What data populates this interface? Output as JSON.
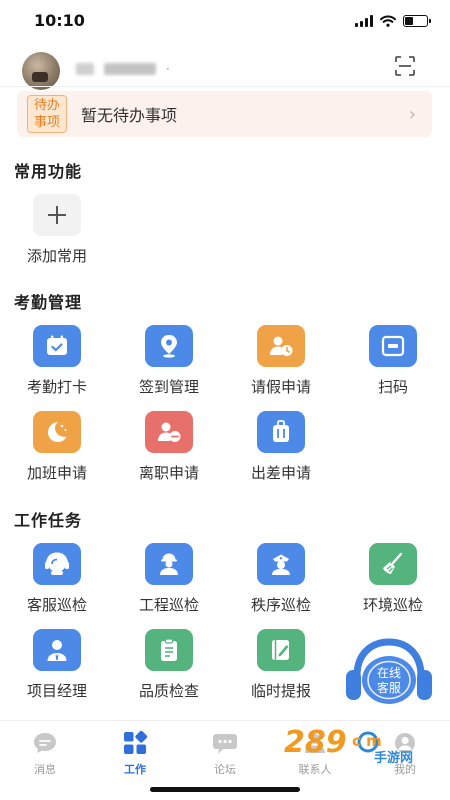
{
  "status_bar": {
    "time": "10:10",
    "battery_level": 0.4
  },
  "header": {
    "avatar_icon": "user-avatar",
    "scan_icon": "scan-icon"
  },
  "todo": {
    "badge_line1": "待办",
    "badge_line2": "事项",
    "message": "暂无待办事项",
    "arrow": "›"
  },
  "common": {
    "title": "常用功能",
    "add_label": "添加常用"
  },
  "attendance": {
    "title": "考勤管理",
    "items": [
      {
        "label": "考勤打卡",
        "icon": "calendar-check-icon",
        "color": "#4d8ae8"
      },
      {
        "label": "签到管理",
        "icon": "location-pin-icon",
        "color": "#4d8ae8"
      },
      {
        "label": "请假申请",
        "icon": "user-clock-icon",
        "color": "#f0a246"
      },
      {
        "label": "扫码",
        "icon": "scan-icon",
        "color": "#4d8ae8"
      },
      {
        "label": "加班申请",
        "icon": "moon-icon",
        "color": "#f0a246"
      },
      {
        "label": "离职申请",
        "icon": "user-minus-icon",
        "color": "#e7706a"
      },
      {
        "label": "出差申请",
        "icon": "suitcase-icon",
        "color": "#4d8ae8"
      }
    ]
  },
  "tasks": {
    "title": "工作任务",
    "items": [
      {
        "label": "客服巡检",
        "icon": "headset-icon",
        "color": "#4d8ae8"
      },
      {
        "label": "工程巡检",
        "icon": "worker-icon",
        "color": "#4d8ae8"
      },
      {
        "label": "秩序巡检",
        "icon": "guard-icon",
        "color": "#4d8ae8"
      },
      {
        "label": "环境巡检",
        "icon": "broom-icon",
        "color": "#55b37d"
      },
      {
        "label": "项目经理",
        "icon": "manager-icon",
        "color": "#4d8ae8"
      },
      {
        "label": "品质检查",
        "icon": "clipboard-icon",
        "color": "#55b37d"
      },
      {
        "label": "临时提报",
        "icon": "notebook-pen-icon",
        "color": "#55b37d"
      }
    ]
  },
  "online_service": {
    "line1": "在线",
    "line2": "客服"
  },
  "tabbar": {
    "items": [
      {
        "label": "消息",
        "icon": "chat-bubble-icon",
        "active": false
      },
      {
        "label": "工作",
        "icon": "grid-icon",
        "active": true
      },
      {
        "label": "论坛",
        "icon": "forum-icon",
        "active": false
      },
      {
        "label": "联系人",
        "icon": "contacts-icon",
        "active": false
      },
      {
        "label": "我的",
        "icon": "profile-icon",
        "active": false
      }
    ]
  },
  "watermark": {
    "brand": "289",
    "suffix": "c m",
    "sub": "手游网"
  }
}
